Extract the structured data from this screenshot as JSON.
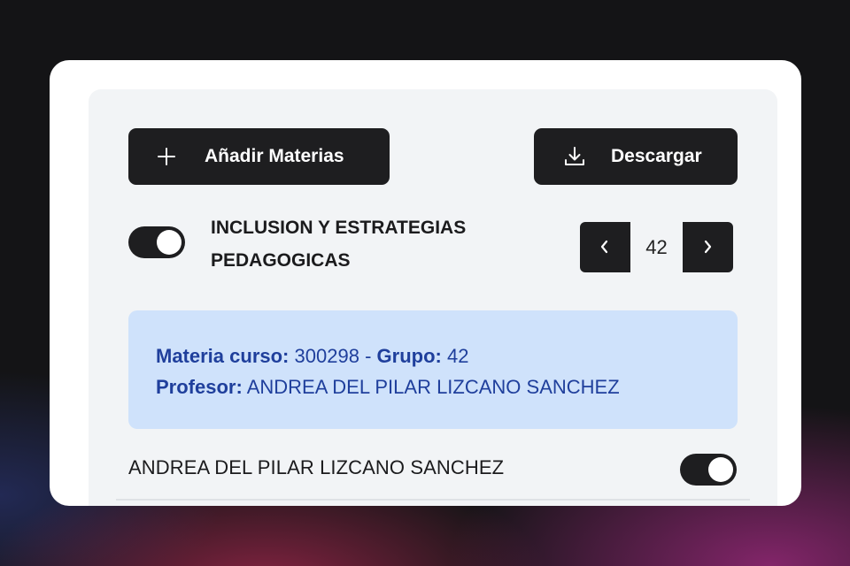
{
  "toolbar": {
    "add_label": "Añadir Materias",
    "download_label": "Descargar"
  },
  "course": {
    "title": "INCLUSION Y ESTRATEGIAS PEDAGOGICAS",
    "toggle_on": true
  },
  "pager": {
    "value": "42"
  },
  "info": {
    "materia_label": "Materia curso:",
    "materia_value": "300298",
    "separator": "-",
    "grupo_label": "Grupo:",
    "grupo_value": "42",
    "profesor_label": "Profesor:",
    "profesor_value": "ANDREA DEL PILAR LIZCANO SANCHEZ"
  },
  "rows": [
    {
      "name": "ANDREA DEL PILAR LIZCANO SANCHEZ",
      "toggle_on": true
    }
  ],
  "icons": {
    "add": "plus-icon",
    "download": "download-icon",
    "prev": "chevron-left-icon",
    "next": "chevron-right-icon"
  },
  "colors": {
    "button_bg": "#1e1e20",
    "info_bg": "#cfe2fb",
    "info_text": "#1f3f9c",
    "panel_bg": "#f2f4f6"
  }
}
